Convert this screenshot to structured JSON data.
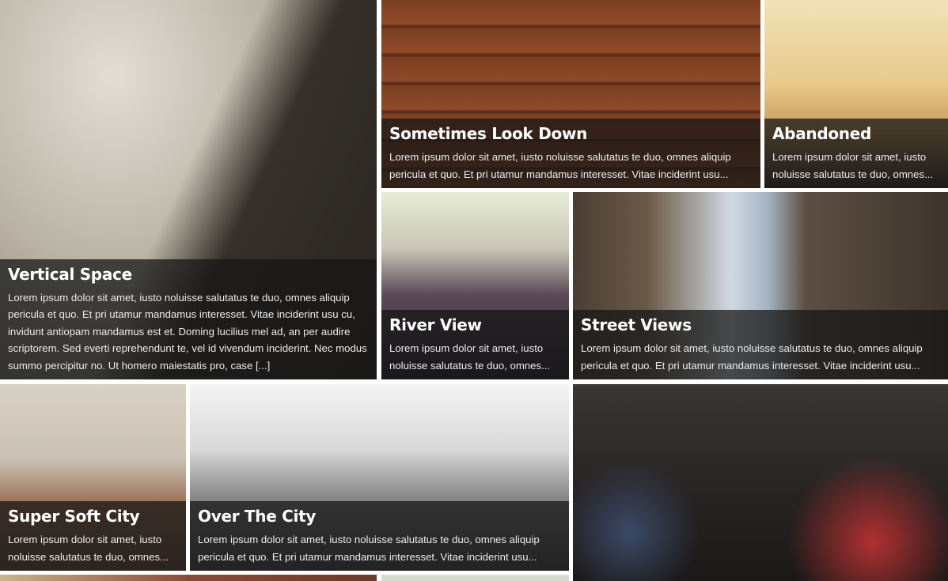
{
  "tiles": [
    {
      "title": "Vertical Space",
      "excerpt": "Lorem ipsum dolor sit amet, iusto noluisse salutatus te duo, omnes aliquip pericula et quo. Et pri utamur mandamus interesset. Vitae inciderint usu cu, invidunt antiopam mandamus est et. Doming lucilius mel ad, an per audire scriptorem. Sed everti reprehendunt te, vel id vivendum inciderint. Nec modus summo percipitur no. Ut homero maiestatis pro, case [...]"
    },
    {
      "title": "Sometimes Look Down",
      "excerpt": "Lorem ipsum dolor sit amet, iusto noluisse salutatus te duo, omnes aliquip pericula et quo. Et pri utamur mandamus interesset. Vitae inciderint usu..."
    },
    {
      "title": "Abandoned",
      "excerpt": "Lorem ipsum dolor sit amet, iusto noluisse salutatus te duo, omnes..."
    },
    {
      "title": "River View",
      "excerpt": "Lorem ipsum dolor sit amet, iusto noluisse salutatus te duo, omnes..."
    },
    {
      "title": "Street Views",
      "excerpt": "Lorem ipsum dolor sit amet, iusto noluisse salutatus te duo, omnes aliquip pericula et quo. Et pri utamur mandamus interesset. Vitae inciderint usu..."
    },
    {
      "title": "Super Soft City",
      "excerpt": "Lorem ipsum dolor sit amet, iusto noluisse salutatus te duo, omnes..."
    },
    {
      "title": "Over The City",
      "excerpt": "Lorem ipsum dolor sit amet, iusto noluisse salutatus te duo, omnes aliquip pericula et quo. Et pri utamur mandamus interesset. Vitae inciderint usu..."
    }
  ],
  "colors": {
    "caption_overlay": "#161616",
    "text": "#ffffff",
    "background": "#ffffff"
  }
}
